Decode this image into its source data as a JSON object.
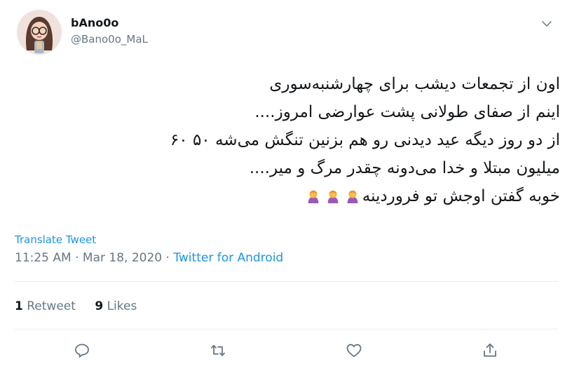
{
  "user": {
    "display_name": "bAno0o",
    "handle": "@Bano0o_MaL"
  },
  "tweet": {
    "lines": [
      "اون از تجمعات دیشب برای چهارشنبه‌سوری",
      "اینم از صفای طولانی پشت عوارضی امروز....",
      "از دو روز دیگه عید دیدنی رو هم بزنین تنگش می‌شه ۵۰ ۶۰",
      "میلیون مبتلا و خدا می‌دونه چقدر مرگ و میر....",
      "خوبه گفتن اوجش تو فروردینه"
    ],
    "trailing_emoji": [
      "woman-facepalming-icon",
      "woman-facepalming-icon",
      "woman-facepalming-icon"
    ]
  },
  "translate_label": "Translate Tweet",
  "meta": {
    "time": "11:25 AM",
    "separator1": " · ",
    "date": "Mar 18, 2020",
    "separator2": " · ",
    "source": "Twitter for Android"
  },
  "stats": {
    "retweets_count": "1",
    "retweets_label": "Retweet",
    "likes_count": "9",
    "likes_label": "Likes"
  },
  "actions": [
    "reply-icon",
    "retweet-icon",
    "like-icon",
    "share-icon"
  ],
  "colors": {
    "link": "#1b95e0",
    "secondary": "#657786",
    "divider": "#e6ecf0",
    "text": "#14171a"
  }
}
